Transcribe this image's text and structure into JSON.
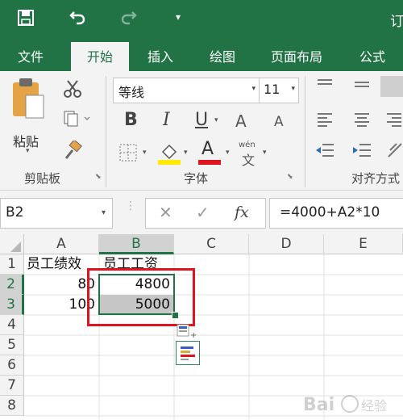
{
  "titlebar": {
    "title_partial": "订"
  },
  "tabs": [
    {
      "label": "文件"
    },
    {
      "label": "开始"
    },
    {
      "label": "插入"
    },
    {
      "label": "绘图"
    },
    {
      "label": "页面布局"
    },
    {
      "label": "公式"
    }
  ],
  "ribbon": {
    "clipboard": {
      "paste_label": "粘贴",
      "group_label": "剪贴板"
    },
    "font": {
      "font_name": "等线",
      "font_size": "11",
      "group_label": "字体",
      "bold": "B",
      "italic": "I",
      "underline": "U",
      "font_color_glyph": "A",
      "grow": "A",
      "shrink": "A",
      "phonetic_top": "wén",
      "phonetic_bottom": "文"
    },
    "align": {
      "group_label": "对齐方式"
    }
  },
  "formula_bar": {
    "name_box": "B2",
    "fx": "fx",
    "formula": "=4000+A2*10"
  },
  "grid": {
    "columns": [
      "A",
      "B",
      "C",
      "D",
      "E"
    ],
    "rows": [
      "1",
      "2",
      "3",
      "4",
      "5",
      "6",
      "7",
      "8"
    ],
    "cells": {
      "A1": "员工绩效",
      "B1": "员工工资",
      "A2": "80",
      "B2": "4800",
      "A3": "100",
      "B3": "5000"
    }
  },
  "colors": {
    "excel_green": "#217346",
    "highlight_red": "#e0141e",
    "fill_yellow": "#ffea00",
    "font_red": "#e0141e"
  },
  "watermark": "Baidu经验"
}
